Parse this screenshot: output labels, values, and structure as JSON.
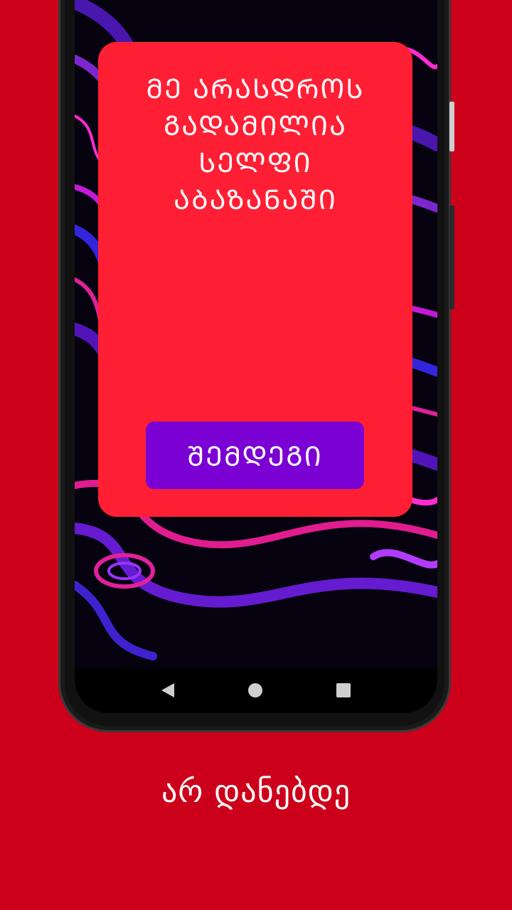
{
  "card": {
    "question_lines": [
      "ᲛᲔ ᲐᲠᲐᲡᲓᲠᲝᲡ",
      "ᲒᲐᲓᲐᲛᲘᲚᲘᲐ",
      "ᲡᲔᲚᲤᲘ",
      "ᲐᲑᲐᲖᲐᲜᲐᲨᲘ"
    ],
    "next_label": "ᲨᲔᲛᲓᲔᲒᲘ"
  },
  "tagline": "არ დანებდე",
  "nav": {
    "icons": [
      "back-icon",
      "home-icon",
      "recent-apps-icon"
    ]
  },
  "colors": {
    "background": "#cc001a",
    "card": "#ff1f34",
    "button": "#7b00d4",
    "text": "#ffffff"
  }
}
